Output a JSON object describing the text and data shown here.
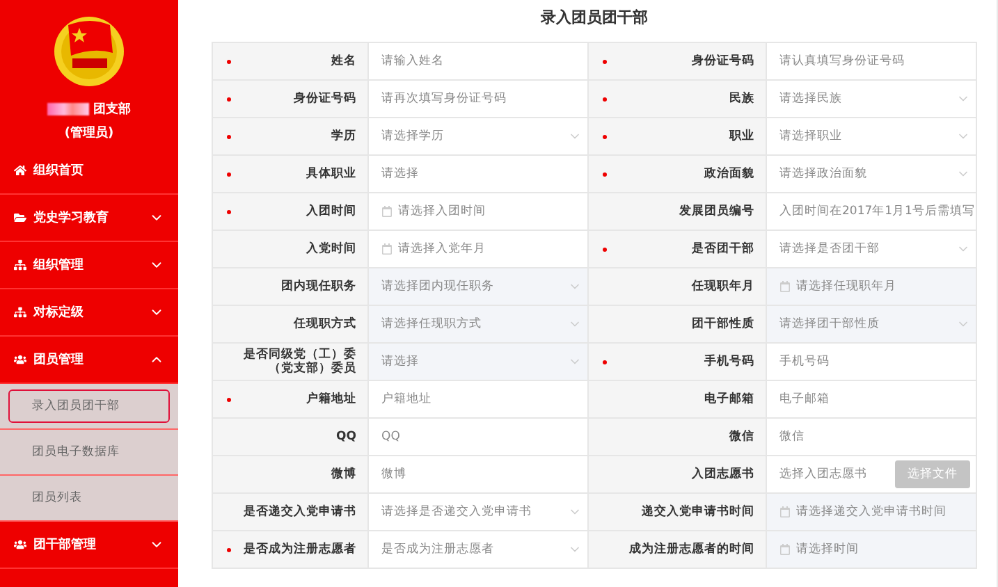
{
  "sidebar": {
    "org_name": "团支部",
    "role": "(管理员)",
    "items": [
      {
        "label": "组织首页",
        "has_children": false
      },
      {
        "label": "党史学习教育",
        "has_children": true,
        "expanded": false
      },
      {
        "label": "组织管理",
        "has_children": true,
        "expanded": false
      },
      {
        "label": "对标定级",
        "has_children": true,
        "expanded": false
      },
      {
        "label": "团员管理",
        "has_children": true,
        "expanded": true,
        "children": [
          {
            "label": "录入团员团干部",
            "selected": true
          },
          {
            "label": "团员电子数据库",
            "selected": false
          },
          {
            "label": "团员列表",
            "selected": false
          }
        ]
      },
      {
        "label": "团干部管理",
        "has_children": true,
        "expanded": false
      }
    ]
  },
  "form": {
    "title": "录入团员团干部",
    "rows": [
      [
        {
          "label": "姓名",
          "required": true,
          "kind": "text",
          "placeholder": "请输入姓名",
          "disabled": false
        },
        {
          "label": "身份证号码",
          "required": true,
          "kind": "text",
          "placeholder": "请认真填写身份证号码",
          "disabled": false
        }
      ],
      [
        {
          "label": "身份证号码",
          "required": true,
          "kind": "text",
          "placeholder": "请再次填写身份证号码",
          "disabled": false
        },
        {
          "label": "民族",
          "required": true,
          "kind": "select",
          "placeholder": "请选择民族",
          "disabled": false
        }
      ],
      [
        {
          "label": "学历",
          "required": true,
          "kind": "select",
          "placeholder": "请选择学历",
          "disabled": false
        },
        {
          "label": "职业",
          "required": true,
          "kind": "select",
          "placeholder": "请选择职业",
          "disabled": false
        }
      ],
      [
        {
          "label": "具体职业",
          "required": true,
          "kind": "text",
          "placeholder": "请选择",
          "disabled": false
        },
        {
          "label": "政治面貌",
          "required": true,
          "kind": "select",
          "placeholder": "请选择政治面貌",
          "disabled": false
        }
      ],
      [
        {
          "label": "入团时间",
          "required": true,
          "kind": "date",
          "placeholder": "请选择入团时间",
          "disabled": false
        },
        {
          "label": "发展团员编号",
          "required": false,
          "kind": "text",
          "placeholder": "入团时间在2017年1月1号后需填写",
          "disabled": false
        }
      ],
      [
        {
          "label": "入党时间",
          "required": false,
          "kind": "date",
          "placeholder": "请选择入党年月",
          "disabled": false
        },
        {
          "label": "是否团干部",
          "required": true,
          "kind": "select",
          "placeholder": "请选择是否团干部",
          "disabled": false
        }
      ],
      [
        {
          "label": "团内现任职务",
          "required": false,
          "kind": "select",
          "placeholder": "请选择团内现任职务",
          "disabled": true
        },
        {
          "label": "任现职年月",
          "required": false,
          "kind": "date",
          "placeholder": "请选择任现职年月",
          "disabled": true
        }
      ],
      [
        {
          "label": "任现职方式",
          "required": false,
          "kind": "select",
          "placeholder": "请选择任现职方式",
          "disabled": true
        },
        {
          "label": "团干部性质",
          "required": false,
          "kind": "select",
          "placeholder": "请选择团干部性质",
          "disabled": true
        }
      ],
      [
        {
          "label": "是否同级党（工）委（党支部）委员",
          "required": false,
          "kind": "select",
          "placeholder": "请选择",
          "disabled": true
        },
        {
          "label": "手机号码",
          "required": true,
          "kind": "text",
          "placeholder": "手机号码",
          "disabled": false
        }
      ],
      [
        {
          "label": "户籍地址",
          "required": true,
          "kind": "text",
          "placeholder": "户籍地址",
          "disabled": false
        },
        {
          "label": "电子邮箱",
          "required": false,
          "kind": "text",
          "placeholder": "电子邮箱",
          "disabled": false
        }
      ],
      [
        {
          "label": "QQ",
          "required": false,
          "kind": "text",
          "placeholder": "QQ",
          "disabled": false
        },
        {
          "label": "微信",
          "required": false,
          "kind": "text",
          "placeholder": "微信",
          "disabled": false
        }
      ],
      [
        {
          "label": "微博",
          "required": false,
          "kind": "text",
          "placeholder": "微博",
          "disabled": false
        },
        {
          "label": "入团志愿书",
          "required": false,
          "kind": "file",
          "placeholder": "选择入团志愿书",
          "button": "选择文件",
          "disabled": false
        }
      ],
      [
        {
          "label": "是否递交入党申请书",
          "required": false,
          "kind": "select",
          "placeholder": "请选择是否递交入党申请书",
          "disabled": false
        },
        {
          "label": "递交入党申请书时间",
          "required": false,
          "kind": "date",
          "placeholder": "请选择递交入党申请书时间",
          "disabled": true
        }
      ],
      [
        {
          "label": "是否成为注册志愿者",
          "required": true,
          "kind": "select",
          "placeholder": "是否成为注册志愿者",
          "disabled": false
        },
        {
          "label": "成为注册志愿者的时间",
          "required": false,
          "kind": "date",
          "placeholder": "请选择时间",
          "disabled": true
        }
      ]
    ]
  }
}
